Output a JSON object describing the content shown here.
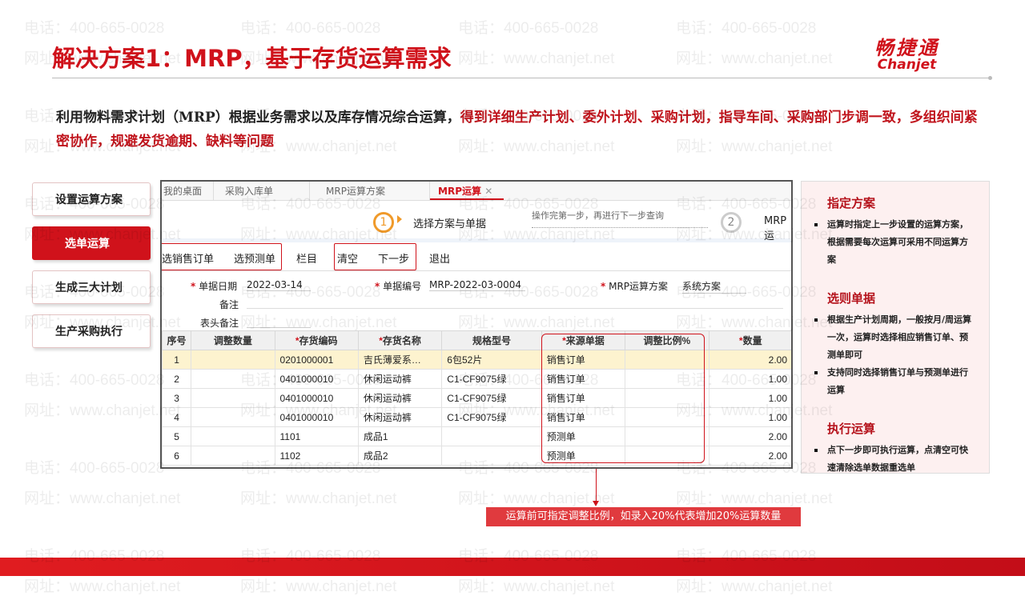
{
  "title": "解决方案1：MRP，基于存货运算需求",
  "logo": {
    "cn": "畅捷通",
    "en": "Chanjet"
  },
  "watermark": {
    "phone": "电话：400-665-0028",
    "site": "网址：www.chanjet.net"
  },
  "intro": {
    "plain": "利用物料需求计划（MRP）根据业务需求以及库存情况综合运算，",
    "highlight": "得到详细生产计划、委外计划、采购计划，指导车间、采购部门步调一致，多组织间紧密协作，规避发货逾期、缺料等问题"
  },
  "steps": [
    "设置运算方案",
    "选单运算",
    "生成三大计划",
    "生产采购执行"
  ],
  "app": {
    "tabs": [
      "我的桌面",
      "采购入库单",
      "MRP运算方案",
      "MRP运算"
    ],
    "step1": "1",
    "step1_label": "选择方案与单据",
    "hint": "操作完第一步，再进行下一步查询",
    "step2": "2",
    "step2_label": "MRP运",
    "toolbar": [
      "选销售订单",
      "选预测单",
      "栏目",
      "清空",
      "下一步",
      "退出"
    ],
    "form": {
      "date_label": "单据日期",
      "date": "2022-03-14",
      "no_label": "单据编号",
      "no": "MRP-2022-03-0004",
      "plan_label": "MRP运算方案",
      "plan": "系统方案",
      "note_label": "备注",
      "head_note_label": "表头备注"
    },
    "columns": [
      "序号",
      "调整数量",
      "存货编码",
      "存货名称",
      "规格型号",
      "来源单据",
      "调整比例%",
      "数量"
    ],
    "rows": [
      [
        "1",
        "",
        "0201000001",
        "吉氏薄爱系…",
        "6包52片",
        "销售订单",
        "",
        "2.00"
      ],
      [
        "2",
        "",
        "0401000010",
        "休闲运动裤",
        "C1-CF9075绿",
        "销售订单",
        "",
        "1.00"
      ],
      [
        "3",
        "",
        "0401000010",
        "休闲运动裤",
        "C1-CF9075绿",
        "销售订单",
        "",
        "1.00"
      ],
      [
        "4",
        "",
        "0401000010",
        "休闲运动裤",
        "C1-CF9075绿",
        "销售订单",
        "",
        "1.00"
      ],
      [
        "5",
        "",
        "1101",
        "成品1",
        "",
        "预测单",
        "",
        "2.00"
      ],
      [
        "6",
        "",
        "1102",
        "成品2",
        "",
        "预测单",
        "",
        "2.00"
      ]
    ]
  },
  "right": [
    {
      "title": "指定方案",
      "items": [
        "运算时指定上一步设置的运算方案，根据需要每次运算可采用不同运算方案"
      ]
    },
    {
      "title": "选则单据",
      "items": [
        "根据生产计划周期，一般按月/周运算一次，运算时选择相应销售订单、预测单即可",
        "支持同时选择销售订单与预测单进行运算"
      ]
    },
    {
      "title": "执行运算",
      "items": [
        "点下一步即可执行运算，点清空可快速清除选单数据重选单"
      ]
    }
  ],
  "callout": "运算前可指定调整比例，如录入20%代表增加20%运算数量"
}
